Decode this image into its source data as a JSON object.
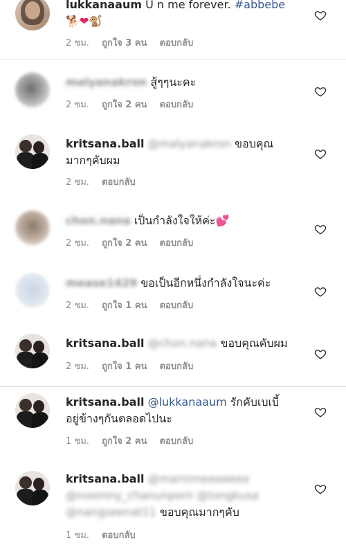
{
  "comments": [
    {
      "username": "lukkanaaum",
      "text": "U n me forever.",
      "hashtag": "#abbebe",
      "emojis": [
        "🐕",
        "❤",
        "🐒"
      ],
      "time": "2 ชม.",
      "likes": "ถูกใจ 3 คน",
      "reply": "ตอบกลับ"
    },
    {
      "username": "malyanakron",
      "text": "สู้ๆๆนะคะ",
      "time": "2 ชม.",
      "likes": "ถูกใจ 2 คน",
      "reply": "ตอบกลับ"
    },
    {
      "username": "kritsana.ball",
      "mention": "@malyanakron",
      "text1": "ขอบคุณ",
      "text2": "มากๆคับผม",
      "time": "2 ชม.",
      "reply": "ตอบกลับ"
    },
    {
      "username": "chon.nana",
      "text": "เป็นกำลังใจให้ค่ะ",
      "emoji": "💕",
      "time": "2 ชม.",
      "likes": "ถูกใจ 2 คน",
      "reply": "ตอบกลับ"
    },
    {
      "username": "mease1429",
      "text": "ขอเป็นอีกหนึ่งกำลังใจนะค่ะ",
      "time": "2 ชม.",
      "likes": "ถูกใจ 1 คน",
      "reply": "ตอบกลับ"
    },
    {
      "username": "kritsana.ball",
      "mention": "@chon.nana",
      "text": "ขอบคุณคับผม",
      "time": "2 ชม.",
      "likes": "ถูกใจ 1 คน",
      "reply": "ตอบกลับ"
    },
    {
      "username": "kritsana.ball",
      "mention": "@lukkanaaum",
      "text1": "รักคับเบเบี้",
      "text2": "อยู่ข้างๆกันตลอดไปนะ",
      "time": "1 ชม.",
      "likes": "ถูกใจ 2 คน",
      "reply": "ตอบกลับ"
    },
    {
      "username": "kritsana.ball",
      "mention1": "@marnimeeeeeee",
      "mention2": "@noomny_chanunporn @tongkusa",
      "mention3": "@nangseenat11",
      "text": "ขอบคุณมากๆคับ",
      "time": "1 ชม.",
      "reply": "ตอบกลับ"
    }
  ],
  "colors": {
    "mention": "#38588f",
    "meta": "#8e8e8e",
    "text": "#262626"
  }
}
